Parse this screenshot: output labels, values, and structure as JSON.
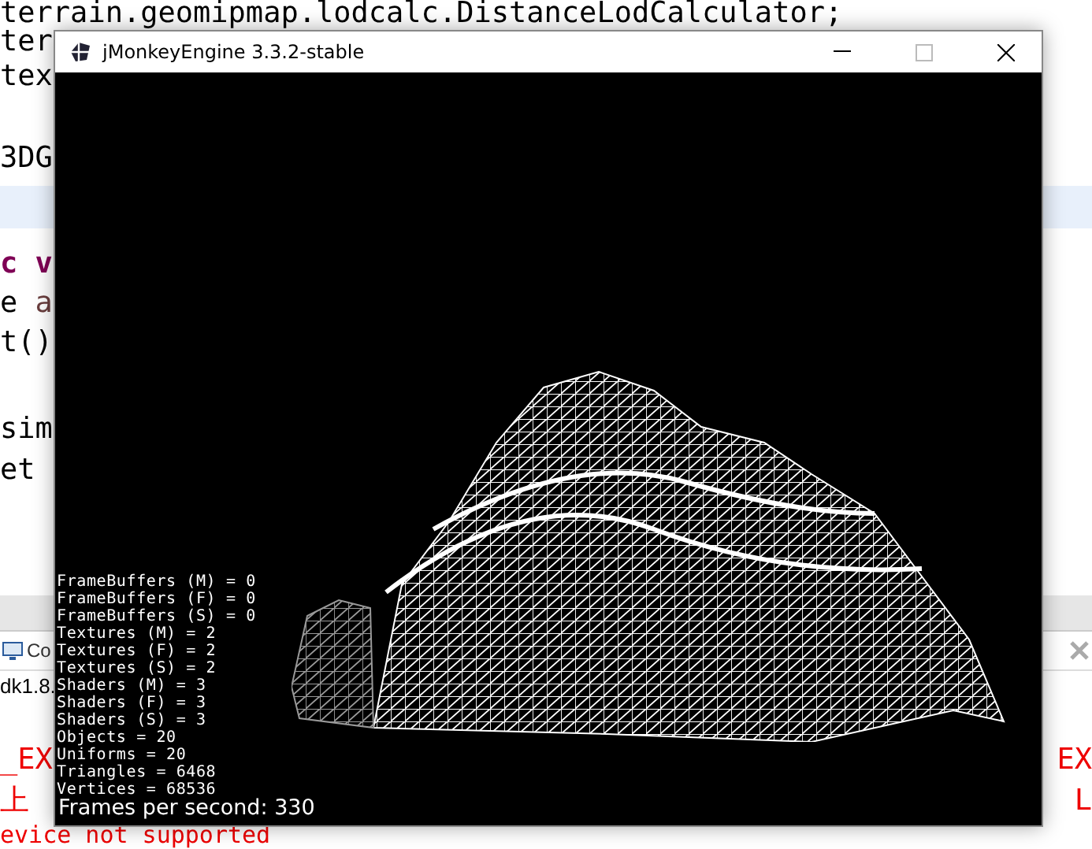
{
  "editor": {
    "lines": [
      {
        "text": "terrain.geomipmap.lodcalc.DistanceLodCalculator;",
        "kind": "code"
      },
      {
        "text": "ter",
        "kind": "code"
      },
      {
        "text": "tex",
        "kind": "code"
      },
      {
        "text": "3DG",
        "kind": "code"
      },
      {
        "text": "c v",
        "kind": "keyword"
      },
      {
        "text": "e a",
        "kind": "mixed"
      },
      {
        "text": "t()",
        "kind": "code"
      },
      {
        "text": "sim",
        "kind": "code"
      },
      {
        "text": "et",
        "kind": "code"
      }
    ]
  },
  "console": {
    "tab": "Co",
    "project": "dk1.8.",
    "errors": [
      {
        "left": "_EX",
        "right": "EX"
      },
      {
        "left": "上",
        "right": "L"
      },
      {
        "left": "evice not supported"
      }
    ]
  },
  "window": {
    "title": "jMonkeyEngine 3.3.2-stable",
    "stats": [
      "FrameBuffers (M) = 0",
      "FrameBuffers (F) = 0",
      "FrameBuffers (S) = 0",
      "Textures (M) = 2",
      "Textures (F) = 2",
      "Textures (S) = 2",
      "Shaders (M) = 3",
      "Shaders (F) = 3",
      "Shaders (S) = 3",
      "Objects = 20",
      "Uniforms = 20",
      "Triangles = 6468",
      "Vertices = 68536"
    ],
    "fps": "Frames per second: 330"
  }
}
